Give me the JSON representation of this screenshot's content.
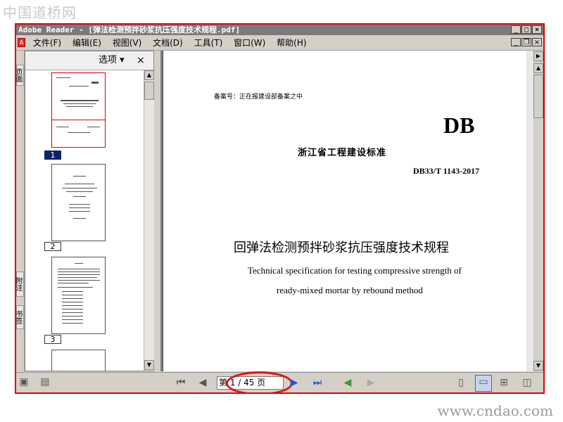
{
  "watermarks": {
    "top": "中国道桥网",
    "bottom": "www.cndao.com"
  },
  "window": {
    "title": "Adobe Reader - [弹法检测预拌砂浆抗压强度技术规程.pdf]"
  },
  "menu": [
    "文件(F)",
    "编辑(E)",
    "视图(V)",
    "文档(D)",
    "工具(T)",
    "窗口(W)",
    "帮助(H)"
  ],
  "nav_tabs": [
    "页面",
    "附注",
    "书签"
  ],
  "panel": {
    "options_label": "选项",
    "close_glyph": "×"
  },
  "thumbnails": [
    {
      "num": "1",
      "selected": true
    },
    {
      "num": "2",
      "selected": false
    },
    {
      "num": "3",
      "selected": false
    }
  ],
  "document": {
    "filing": "备案号：正在报建设部备案之中",
    "db": "DB",
    "standard_org": "浙江省工程建设标准",
    "code": "DB33/T 1143-2017",
    "title_cn": "回弹法检测预拌砂浆抗压强度技术规程",
    "title_en_1": "Technical specification for testing compressive strength of",
    "title_en_2": "ready-mixed mortar by rebound method"
  },
  "status": {
    "page_display": "第 1 / 45 页"
  },
  "icons": {
    "first_page": "first-page-icon",
    "prev_page": "prev-page-icon",
    "next_page": "next-page-icon",
    "last_page": "last-page-icon",
    "back": "back-icon",
    "forward": "forward-icon"
  },
  "colors": {
    "highlight": "#e01010",
    "selected_page": "#0a246a",
    "nav_green": "#3a9a3a"
  }
}
